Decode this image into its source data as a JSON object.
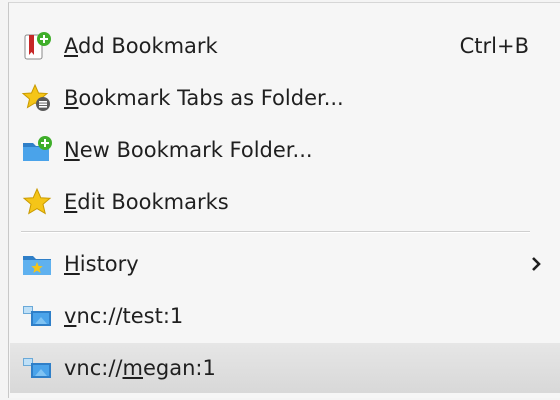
{
  "menu": {
    "items": [
      {
        "icon": "bookmark-add-icon",
        "accel_letter": "A",
        "label_rest": "dd Bookmark",
        "shortcut": "Ctrl+B"
      },
      {
        "icon": "bookmark-tabs-icon",
        "accel_letter": "B",
        "label_rest": "ookmark Tabs as Folder..."
      },
      {
        "icon": "new-folder-icon",
        "accel_letter": "N",
        "label_rest": "ew Bookmark Folder..."
      },
      {
        "icon": "star-icon",
        "accel_letter": "E",
        "label_rest": "dit Bookmarks"
      },
      {
        "icon": "history-folder-icon",
        "accel_letter": "H",
        "label_rest": "istory",
        "submenu_arrow": "chevron-right-icon"
      },
      {
        "icon": "remote-desktop-icon",
        "accel_letter": "v",
        "label_rest": "nc://test:1"
      },
      {
        "icon": "remote-desktop-icon",
        "label_prefix": "vnc://",
        "accel_letter": "m",
        "label_rest": "egan:1",
        "highlighted": true
      }
    ]
  },
  "colors": {
    "text": "#1f1f1f",
    "highlight": "#dcdcdc",
    "folder_blue": "#3a8fd6",
    "star_yellow": "#f5c518",
    "plus_green": "#3fae2a"
  }
}
